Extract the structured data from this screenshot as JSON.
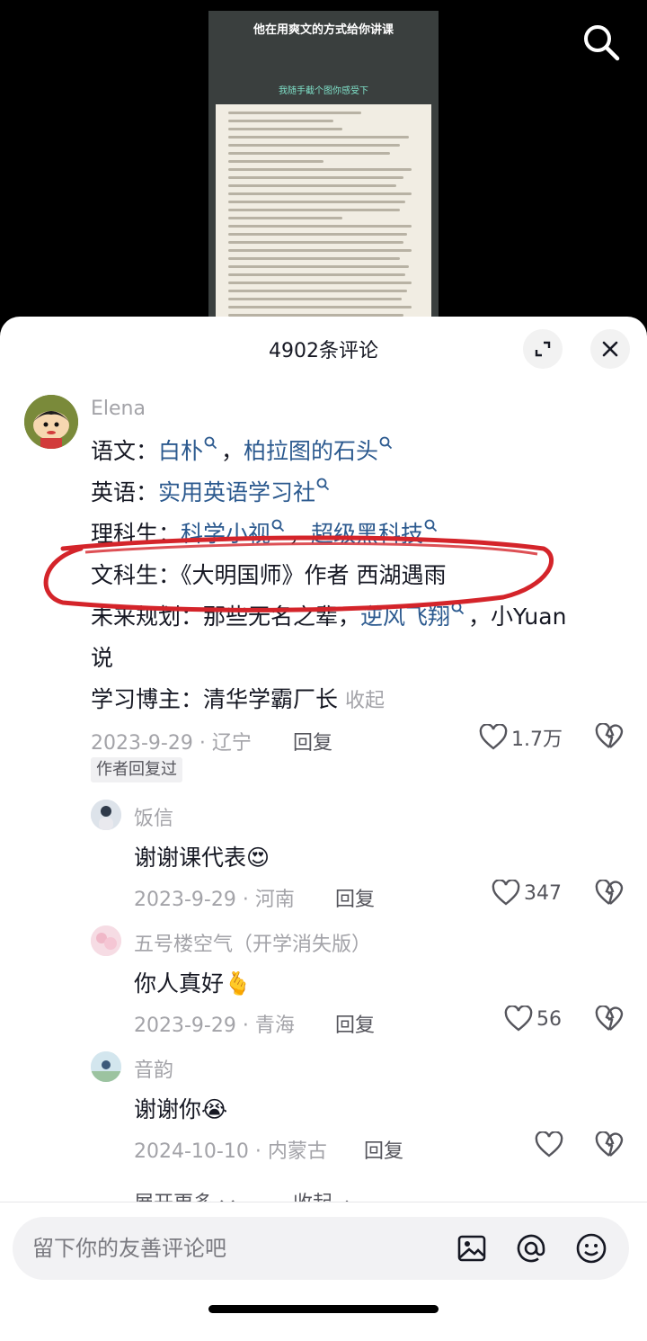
{
  "video": {
    "title": "他在用爽文的方式给你讲课",
    "caption": "我随手截个图你感受下"
  },
  "sheet": {
    "title": "4902条评论"
  },
  "main_comment": {
    "username": "Elena",
    "line1": {
      "label": "语文：",
      "link1": "白朴",
      "sep": "，",
      "link2": "柏拉图的石头"
    },
    "line2": {
      "label": "英语：",
      "link1": "实用英语学习社"
    },
    "line3": {
      "label": "理科生：",
      "link1": "科学小视",
      "sep": "，",
      "link2": "超级黑科技"
    },
    "line4": {
      "text": "文科生：《大明国师》作者 西湖遇雨"
    },
    "line5": {
      "label": "未来规划：那些无名之辈，",
      "link1": "逆风飞翔",
      "after": "，小Yuan"
    },
    "line6": {
      "text": "说"
    },
    "line7": {
      "text": "学习博主：清华学霸厂长",
      "collapse": "收起"
    },
    "date_location": "2023-9-29 · 辽宁",
    "reply_label": "回复",
    "likes": "1.7万",
    "badge": "作者回复过"
  },
  "replies": [
    {
      "username": "饭信",
      "text": "谢谢课代表",
      "emoji": "😍",
      "date_location": "2023-9-29 · 河南",
      "reply_label": "回复",
      "likes": "347"
    },
    {
      "username": "五号楼空气（开学消失版）",
      "text": "你人真好",
      "emoji": "🫰",
      "date_location": "2023-9-29 · 青海",
      "reply_label": "回复",
      "likes": "56"
    },
    {
      "username": "音韵",
      "text": "谢谢你",
      "emoji": "😭",
      "date_location": "2024-10-10 · 内蒙古",
      "reply_label": "回复",
      "likes": ""
    }
  ],
  "more": {
    "expand": "展开更多",
    "collapse": "收起"
  },
  "input": {
    "placeholder": "留下你的友善评论吧"
  },
  "colors": {
    "link": "#2c5a8f",
    "highlight": "#d4242a",
    "muted": "#a3a3a8"
  }
}
